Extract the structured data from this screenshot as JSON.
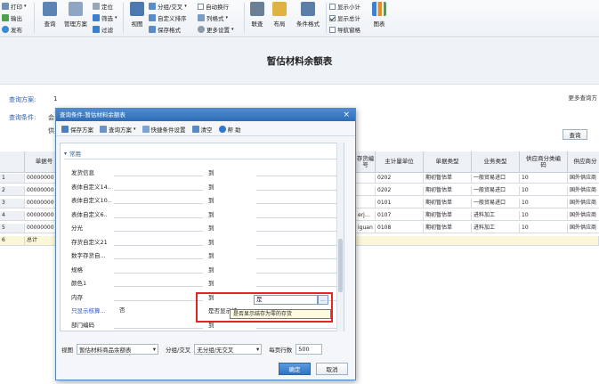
{
  "ribbon": {
    "print": "打印",
    "export": "输出",
    "publish": "发布",
    "query": "查询",
    "manage_plan": "管理方案",
    "locate": "定位",
    "filter": "筛选",
    "filter2": "过滤",
    "view": "视图",
    "group_cross": "分组/交叉",
    "custom_sort": "自定义排序",
    "save_format": "保存格式",
    "auto_wrap": "自动换行",
    "column_format": "列格式",
    "more_settings": "更多设置",
    "link_query": "联查",
    "layout": "布局",
    "cond_format": "条件格式",
    "show_subtotal": "显示小计",
    "show_total": "显示总计",
    "nav_window": "导航窗格",
    "chart": "图表"
  },
  "page": {
    "title": "暂估材料余额表"
  },
  "query": {
    "plan_label": "查询方案:",
    "plan_value": "1",
    "cond_label": "查询条件:",
    "cond_prefix": "会",
    "cond_second": "供",
    "more_link": "更多查询方",
    "query_button": "查询"
  },
  "grid": {
    "headers": {
      "doc_no": "单据号",
      "invno": "存货编号",
      "unit": "主计量单位",
      "doc_type": "单据类型",
      "biz_type": "业务类型",
      "supplier_cat": "供应商分类编码",
      "supplier_cat2": "供应商分"
    },
    "rows": [
      {
        "n": "1",
        "doc": "00000000",
        "code": "",
        "unit": "0202",
        "type": "期初暂估单",
        "biz": "一般贸易进口",
        "cat": "10",
        "cat2": "国外供应商"
      },
      {
        "n": "2",
        "doc": "00000000",
        "code": "",
        "unit": "0202",
        "type": "期初暂估单",
        "biz": "一般贸易进口",
        "cat": "10",
        "cat2": "国外供应商"
      },
      {
        "n": "3",
        "doc": "00000000",
        "code": "",
        "unit": "0101",
        "type": "期初暂估单",
        "biz": "一般贸易进口",
        "cat": "10",
        "cat2": "国外供应商"
      },
      {
        "n": "4",
        "doc": "00000000",
        "code": "erj…",
        "unit": "0107",
        "type": "期初暂估单",
        "biz": "进料加工",
        "cat": "10",
        "cat2": "国外供应商"
      },
      {
        "n": "5",
        "doc": "00000000",
        "code": "iguan",
        "unit": "0108",
        "type": "期初暂估单",
        "biz": "进料加工",
        "cat": "10",
        "cat2": "国外供应商"
      }
    ],
    "total_row": {
      "n": "6",
      "label": "总计"
    }
  },
  "dialog": {
    "title": "查询条件-暂估材料余额表",
    "toolbar": {
      "save_plan": "保存方案",
      "query_plan": "查询方案",
      "quick_cond": "快捷条件设置",
      "clear": "清空",
      "help": "帮 助"
    },
    "section": "常用",
    "to_label": "到",
    "conditions": [
      {
        "name": "发货信息",
        "val": ""
      },
      {
        "name": "表体自定义14..",
        "val": ""
      },
      {
        "name": "表体自定义10..",
        "val": ""
      },
      {
        "name": "表体自定义6..",
        "val": ""
      },
      {
        "name": "分光",
        "val": ""
      },
      {
        "name": "存货自定义21",
        "val": ""
      },
      {
        "name": "数字存货自...",
        "val": ""
      },
      {
        "name": "规格",
        "val": ""
      },
      {
        "name": "颜色1",
        "val": ""
      },
      {
        "name": "内存",
        "val": ""
      },
      {
        "name": "只显示核算...",
        "val": "否"
      },
      {
        "name": "部门编码",
        "val": ""
      }
    ],
    "show_zero_label": "是否显示结...",
    "show_zero_value": "是",
    "tooltip": "是否显示结存为零的存货",
    "bottom": {
      "view_label": "视图",
      "view_value": "暂估材料商品余额表",
      "group_label": "分组/交叉",
      "group_value": "无分组/无交叉",
      "rows_label": "每页行数",
      "rows_value": "500"
    },
    "ok": "确定",
    "cancel": "取消"
  }
}
